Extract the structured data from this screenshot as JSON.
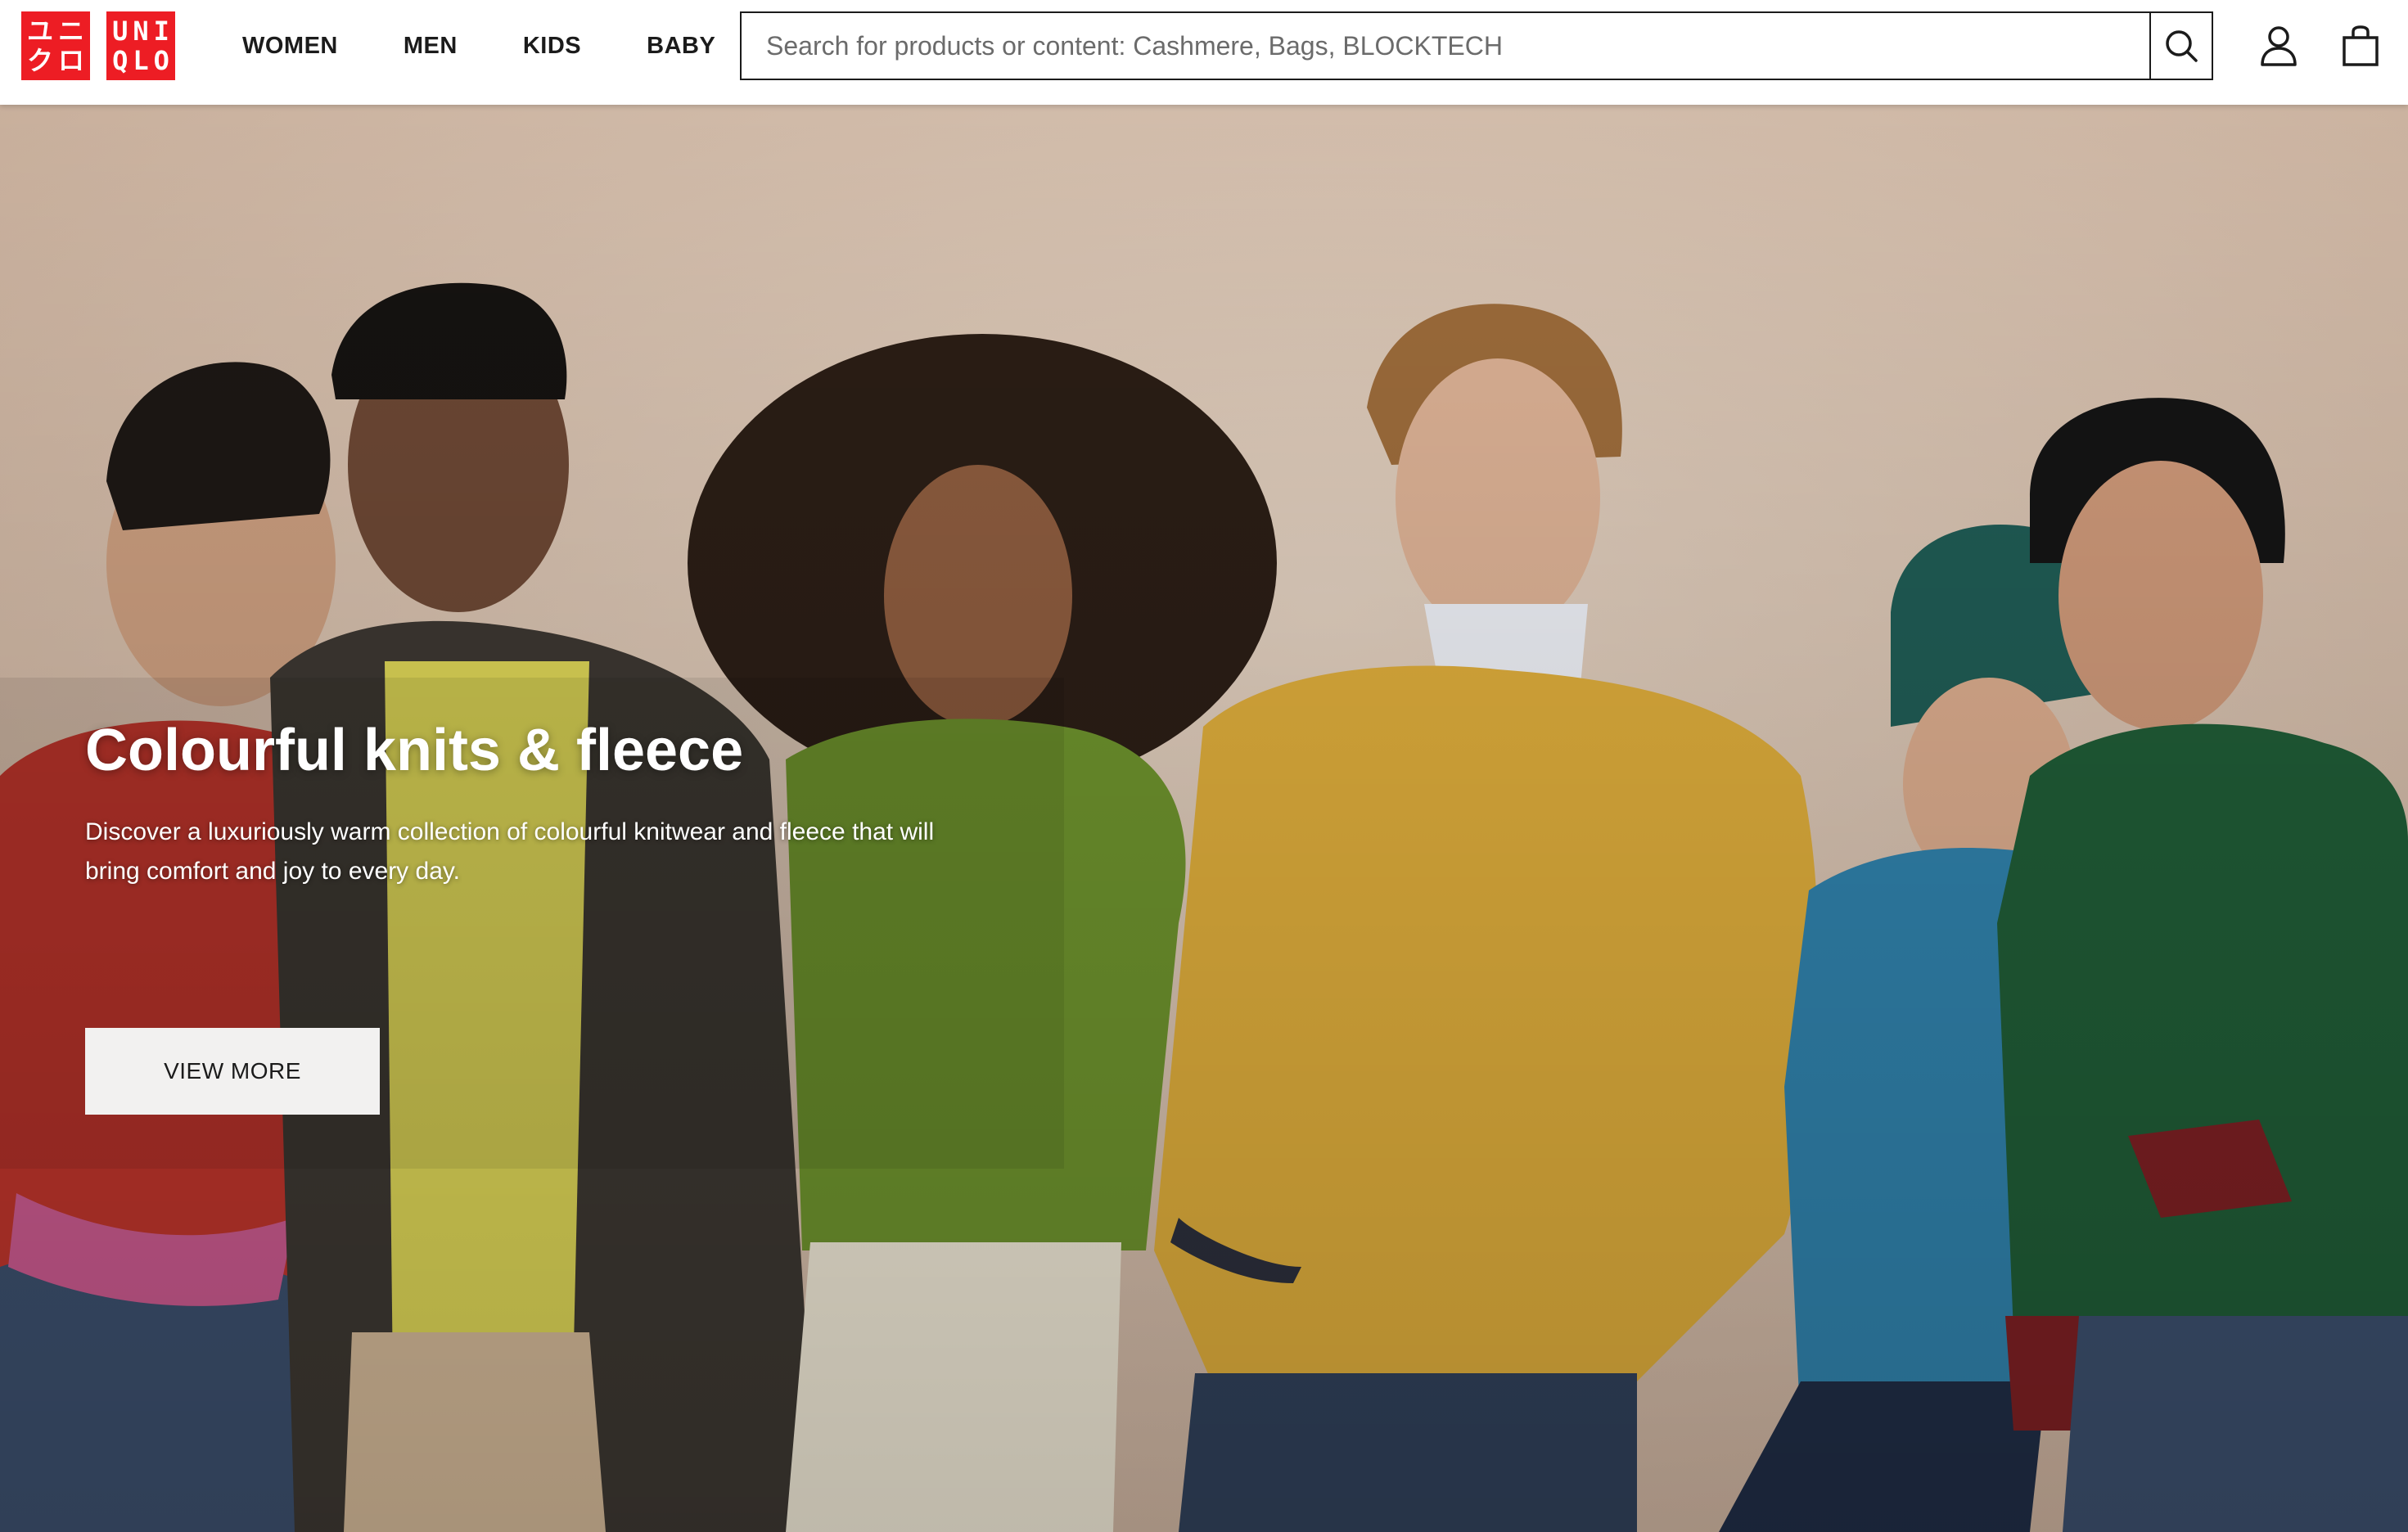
{
  "brand": {
    "logo_tile_1": [
      "ユニ",
      "クロ"
    ],
    "logo_tile_2": [
      "UNI",
      "QLO"
    ],
    "color": "#ed1d24"
  },
  "nav": {
    "items": [
      {
        "label": "WOMEN"
      },
      {
        "label": "MEN"
      },
      {
        "label": "KIDS"
      },
      {
        "label": "BABY"
      }
    ]
  },
  "search": {
    "placeholder": "Search for products or content: Cashmere, Bags, BLOCKTECH",
    "value": "",
    "icon": "search-icon"
  },
  "header_icons": {
    "account": "user-icon",
    "cart": "shopping-bag-icon"
  },
  "hero": {
    "title": "Colourful knits & fleece",
    "description": "Discover a luxuriously warm collection of colourful knitwear and fleece that will bring comfort and joy to every day.",
    "cta_label": "VIEW MORE",
    "image_subject": "six models in colourful knitwear",
    "palette": {
      "background": "#d2bfad",
      "red_knit": "#b8332a",
      "yellow_knit": "#d9a93a",
      "green_knit": "#6b8f2c",
      "blue_knit": "#2f7fa8",
      "dark_green_knit": "#1f5a35",
      "denim": "#3a4d6a"
    }
  }
}
